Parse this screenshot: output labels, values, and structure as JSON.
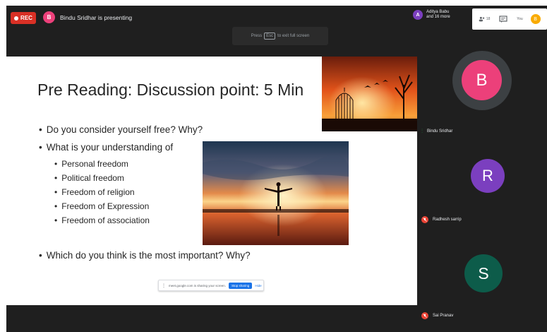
{
  "topbar": {
    "rec_label": "REC",
    "presenter_initial": "B",
    "presenter_text": "Bindu Sridhar is presenting",
    "fullscreen_hint_pre": "Press",
    "fullscreen_key": "Esc",
    "fullscreen_hint_post": "to exit full screen",
    "more_people_initial": "A",
    "more_people_line1": "Aditya Babu",
    "more_people_line2": "and 16 more",
    "people_count": "18",
    "you_label": "You",
    "you_initial": "B"
  },
  "slide": {
    "title": "Pre Reading: Discussion point:  5 Min",
    "bullets": [
      "Do you consider yourself free?  Why?",
      "What is your understanding of"
    ],
    "sub_bullets": [
      "Personal freedom",
      "Political freedom",
      "Freedom of religion",
      "Freedom of Expression",
      "Freedom of association"
    ],
    "last_bullet": "Which do you think is the most important?  Why?"
  },
  "share_bar": {
    "text": "meet.google.com is sharing your screen.",
    "stop_label": "Stop sharing",
    "hide_label": "Hide"
  },
  "participants": [
    {
      "initial": "B",
      "name": "Bindu Sridhar",
      "color": "#ec407a",
      "muted": false
    },
    {
      "initial": "R",
      "name": "Radhesh sarrip",
      "color": "#7b3fbf",
      "muted": true
    },
    {
      "initial": "S",
      "name": "Sai Pranav",
      "color": "#0d5c4a",
      "muted": true
    }
  ],
  "colors": {
    "rec": "#d93025",
    "presenter_avatar": "#ec407a",
    "more_avatar": "#7b3fbf",
    "muted_icon": "#ea4335",
    "speaking_icon": "#1e8e3e"
  }
}
